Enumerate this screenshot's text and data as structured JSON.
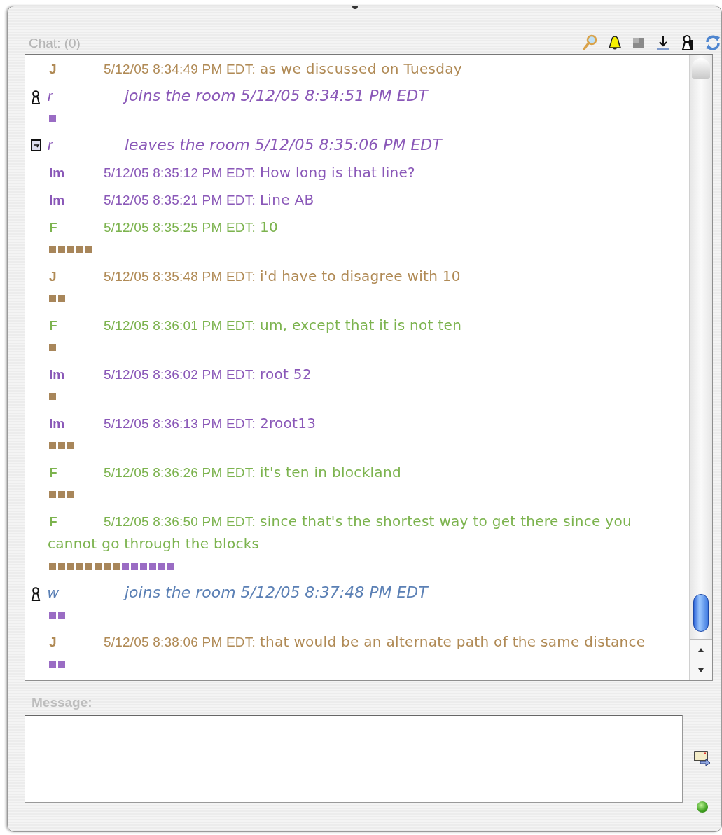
{
  "header": {
    "title": "Chat: (0)"
  },
  "messages": [
    {
      "kind": "message",
      "name": "J",
      "color": "#b08a55",
      "time": "5/12/05 8:34:49 PM EDT:",
      "text": "as we discussed on Tuesday"
    },
    {
      "kind": "join",
      "name": "r",
      "color": "#8a58b8",
      "text": "joins the room 5/12/05 8:34:51 PM EDT",
      "squares": [
        {
          "color": "#9a6cc4"
        }
      ]
    },
    {
      "kind": "leave",
      "name": "r",
      "color": "#8a58b8",
      "text": "leaves the room 5/12/05 8:35:06 PM EDT"
    },
    {
      "kind": "message",
      "name": "Im",
      "color": "#8a58b8",
      "time": "5/12/05 8:35:12 PM EDT:",
      "text": "How long is that line?"
    },
    {
      "kind": "message",
      "name": "Im",
      "color": "#8a58b8",
      "time": "5/12/05 8:35:21 PM EDT:",
      "text": "Line AB"
    },
    {
      "kind": "message",
      "name": "F",
      "color": "#7cb34e",
      "time": "5/12/05 8:35:25 PM EDT:",
      "text": "10",
      "squares": [
        {
          "color": "#a8865a"
        },
        {
          "color": "#a8865a"
        },
        {
          "color": "#a8865a"
        },
        {
          "color": "#a8865a"
        },
        {
          "color": "#a8865a"
        }
      ]
    },
    {
      "kind": "message",
      "name": "J",
      "color": "#b08a55",
      "time": "5/12/05 8:35:48 PM EDT:",
      "text": "i'd have to disagree with 10",
      "squares": [
        {
          "color": "#a8865a"
        },
        {
          "color": "#a8865a"
        }
      ]
    },
    {
      "kind": "message",
      "name": "F",
      "color": "#7cb34e",
      "time": "5/12/05 8:36:01 PM EDT:",
      "text": "um, except that it is not ten",
      "squares": [
        {
          "color": "#a8865a"
        }
      ]
    },
    {
      "kind": "message",
      "name": "Im",
      "color": "#8a58b8",
      "time": "5/12/05 8:36:02 PM EDT:",
      "text": "root 52",
      "squares": [
        {
          "color": "#a8865a"
        }
      ]
    },
    {
      "kind": "message",
      "name": "Im",
      "color": "#8a58b8",
      "time": "5/12/05 8:36:13 PM EDT:",
      "text": "2root13",
      "squares": [
        {
          "color": "#a8865a"
        },
        {
          "color": "#a8865a"
        },
        {
          "color": "#a8865a"
        }
      ]
    },
    {
      "kind": "message",
      "name": "F",
      "color": "#7cb34e",
      "time": "5/12/05 8:36:26 PM EDT:",
      "text": "it's ten in blockland",
      "squares": [
        {
          "color": "#a8865a"
        },
        {
          "color": "#a8865a"
        },
        {
          "color": "#a8865a"
        }
      ]
    },
    {
      "kind": "message",
      "name": "F",
      "color": "#7cb34e",
      "time": "5/12/05 8:36:50 PM EDT:",
      "text": "since that's the shortest way to get there since you cannot go through the blocks",
      "squares": [
        {
          "color": "#a8865a"
        },
        {
          "color": "#a8865a"
        },
        {
          "color": "#a8865a"
        },
        {
          "color": "#a8865a"
        },
        {
          "color": "#a8865a"
        },
        {
          "color": "#a8865a"
        },
        {
          "color": "#a8865a"
        },
        {
          "color": "#a8865a"
        },
        {
          "color": "#9a6cc4"
        },
        {
          "color": "#9a6cc4"
        },
        {
          "color": "#9a6cc4"
        },
        {
          "color": "#9a6cc4"
        },
        {
          "color": "#9a6cc4"
        },
        {
          "color": "#9a6cc4"
        }
      ]
    },
    {
      "kind": "join",
      "name": "w",
      "color": "#5b80b5",
      "text": "joins the room 5/12/05 8:37:48 PM EDT",
      "squares": [
        {
          "color": "#9a6cc4"
        },
        {
          "color": "#9a6cc4"
        }
      ]
    },
    {
      "kind": "message",
      "name": "J",
      "color": "#b08a55",
      "time": "5/12/05 8:38:06 PM EDT:",
      "text": "that would be an alternate path of the same distance",
      "squares": [
        {
          "color": "#9a6cc4"
        },
        {
          "color": "#9a6cc4"
        }
      ]
    }
  ],
  "composer": {
    "label": "Message:"
  },
  "status": {
    "connected": true
  }
}
